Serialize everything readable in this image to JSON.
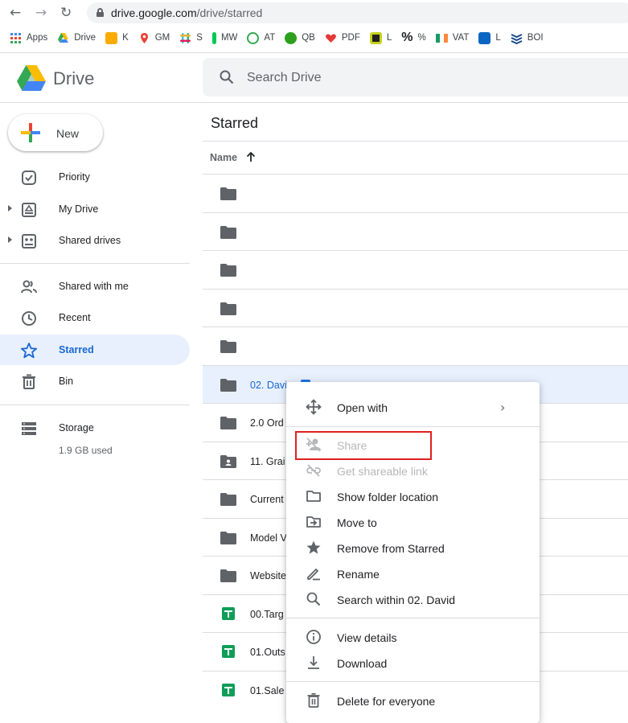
{
  "browser": {
    "url_host": "drive.google.com",
    "url_path": "/drive/starred",
    "bookmarks": [
      {
        "label": "Apps",
        "color": "#4285f4"
      },
      {
        "label": "Drive",
        "color": "#34a853"
      },
      {
        "label": "K",
        "color": "#f9ab00"
      },
      {
        "label": "GM",
        "color": "#ea4335"
      },
      {
        "label": "S",
        "color": "#e01e5a"
      },
      {
        "label": "MW",
        "color": "#00c853"
      },
      {
        "label": "AT",
        "color": "#34a853"
      },
      {
        "label": "QB",
        "color": "#2ca01c"
      },
      {
        "label": "PDF",
        "color": "#e53935"
      },
      {
        "label": "L",
        "color": "#c6d21d"
      },
      {
        "label": "%",
        "color": "#202124"
      },
      {
        "label": "VAT",
        "color": "#ff8f00"
      },
      {
        "label": "L",
        "color": "#0a66c2"
      },
      {
        "label": "BOI",
        "color": "#1a4b8c"
      }
    ]
  },
  "app": {
    "name": "Drive",
    "search_placeholder": "Search Drive"
  },
  "sidebar": {
    "new_label": "New",
    "items": [
      {
        "label": "Priority",
        "icon": "priority-icon"
      },
      {
        "label": "My Drive",
        "icon": "my-drive-icon"
      },
      {
        "label": "Shared drives",
        "icon": "shared-drives-icon"
      },
      {
        "label": "Shared with me",
        "icon": "shared-with-me-icon"
      },
      {
        "label": "Recent",
        "icon": "clock-icon"
      },
      {
        "label": "Starred",
        "icon": "star-icon"
      },
      {
        "label": "Bin",
        "icon": "bin-icon"
      },
      {
        "label": "Storage",
        "icon": "storage-icon"
      }
    ],
    "storage_used": "1.9 GB used"
  },
  "main": {
    "title": "Starred",
    "column_name": "Name",
    "rows": [
      {
        "name": "",
        "icon": "folder-icon"
      },
      {
        "name": "",
        "icon": "folder-icon"
      },
      {
        "name": "",
        "icon": "folder-icon"
      },
      {
        "name": "",
        "icon": "folder-icon"
      },
      {
        "name": "",
        "icon": "folder-icon"
      },
      {
        "name": "02. Davi",
        "icon": "folder-icon"
      },
      {
        "name": "2.0 Ord",
        "icon": "folder-icon"
      },
      {
        "name": "11. Grai",
        "icon": "shared-folder-icon"
      },
      {
        "name": "Current",
        "icon": "folder-icon"
      },
      {
        "name": "Model V",
        "icon": "folder-icon"
      },
      {
        "name": "Website",
        "icon": "folder-icon"
      },
      {
        "name": "00.Targ",
        "icon": "sheets-icon"
      },
      {
        "name": "01.Outs",
        "icon": "sheets-icon"
      },
      {
        "name": "01.Sale",
        "icon": "sheets-icon"
      }
    ]
  },
  "context_menu": {
    "items": [
      {
        "label": "Open with",
        "icon": "open-with-icon"
      },
      {
        "label": "Share",
        "icon": "share-icon"
      },
      {
        "label": "Get shareable link",
        "icon": "link-icon"
      },
      {
        "label": "Show folder location",
        "icon": "folder-outline-icon"
      },
      {
        "label": "Move to",
        "icon": "move-to-icon"
      },
      {
        "label": "Remove from Starred",
        "icon": "star-filled-icon"
      },
      {
        "label": "Rename",
        "icon": "pencil-icon"
      },
      {
        "label": "Search within 02. David",
        "icon": "search-icon"
      },
      {
        "label": "View details",
        "icon": "info-icon"
      },
      {
        "label": "Download",
        "icon": "download-icon"
      },
      {
        "label": "Delete for everyone",
        "icon": "trash-icon"
      }
    ]
  }
}
